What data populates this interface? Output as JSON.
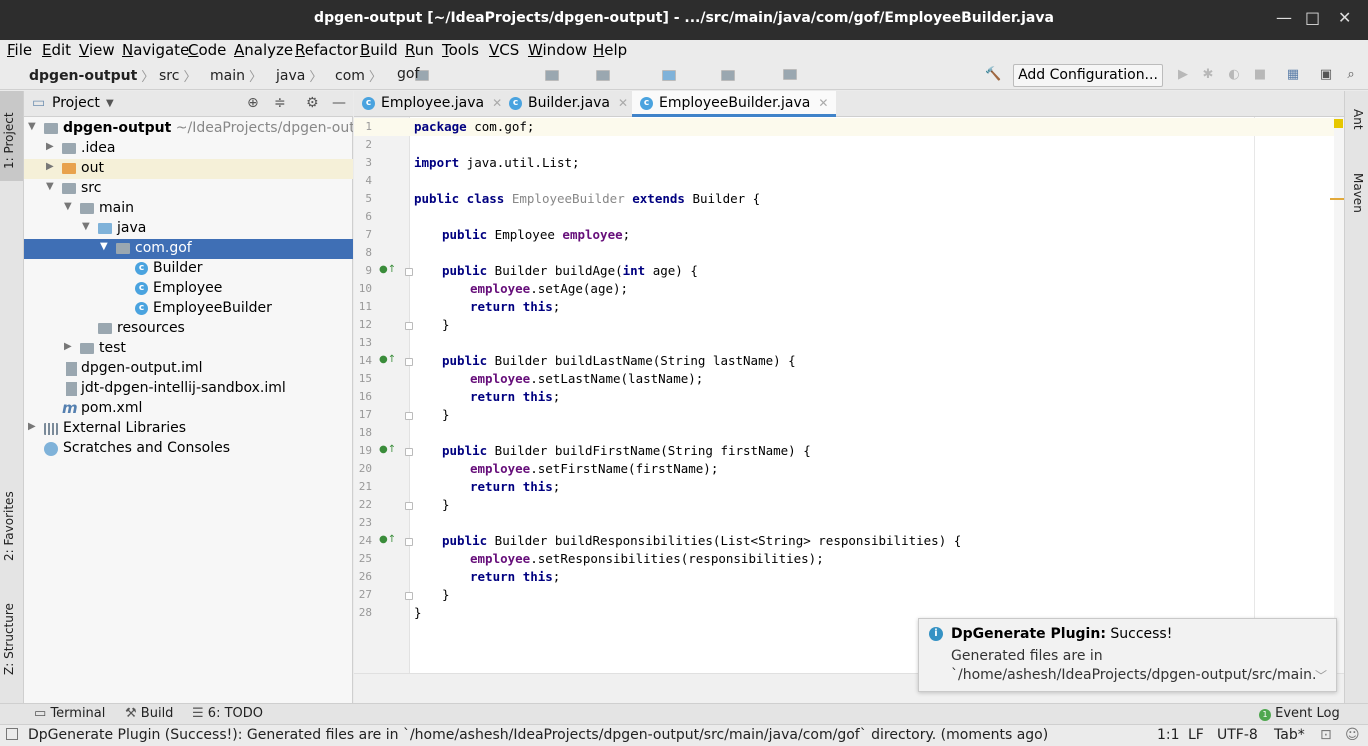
{
  "window": {
    "title": "dpgen-output [~/IdeaProjects/dpgen-output] - .../src/main/java/com/gof/EmployeeBuilder.java",
    "minimize": "—",
    "maximize": "□",
    "close": "✕"
  },
  "menu": [
    "File",
    "Edit",
    "View",
    "Navigate",
    "Code",
    "Analyze",
    "Refactor",
    "Build",
    "Run",
    "Tools",
    "VCS",
    "Window",
    "Help"
  ],
  "breadcrumb": [
    "dpgen-output",
    "src",
    "main",
    "java",
    "com",
    "gof"
  ],
  "toolbar": {
    "add_configuration": "Add Configuration..."
  },
  "left_strip": {
    "project": "1: Project",
    "favorites": "2: Favorites",
    "structure": "Z: Structure"
  },
  "right_strip": {
    "ant": "Ant",
    "maven": "Maven"
  },
  "project_panel": {
    "title": "Project",
    "tree": [
      {
        "label": "dpgen-output",
        "hint": "~/IdeaProjects/dpgen-output"
      },
      {
        "label": ".idea"
      },
      {
        "label": "out"
      },
      {
        "label": "src"
      },
      {
        "label": "main"
      },
      {
        "label": "java"
      },
      {
        "label": "com.gof"
      },
      {
        "label": "Builder"
      },
      {
        "label": "Employee"
      },
      {
        "label": "EmployeeBuilder"
      },
      {
        "label": "resources"
      },
      {
        "label": "test"
      },
      {
        "label": "dpgen-output.iml"
      },
      {
        "label": "jdt-dpgen-intellij-sandbox.iml"
      },
      {
        "label": "pom.xml"
      },
      {
        "label": "External Libraries"
      },
      {
        "label": "Scratches and Consoles"
      }
    ]
  },
  "tabs": [
    "Employee.java",
    "Builder.java",
    "EmployeeBuilder.java"
  ],
  "editor": {
    "line_numbers": [
      "1",
      "2",
      "3",
      "4",
      "5",
      "6",
      "7",
      "8",
      "9",
      "10",
      "11",
      "12",
      "13",
      "14",
      "15",
      "16",
      "17",
      "18",
      "19",
      "20",
      "21",
      "22",
      "23",
      "24",
      "25",
      "26",
      "27",
      "28"
    ],
    "code": {
      "l1_kw": "package",
      "l1_rest": " com.gof;",
      "l3_kw": "import",
      "l3_rest": " java.util.List;",
      "l5_kw1": "public class",
      "l5_name": " EmployeeBuilder ",
      "l5_kw2": "extends",
      "l5_rest": " Builder {",
      "l7_kw": "public",
      "l7_type": " Employee ",
      "l7_fld": "employee",
      "l7_rest": ";",
      "l9_kw": "public",
      "l9_a": " Builder buildAge(",
      "l9_kw2": "int",
      "l9_b": " age) {",
      "l10_fld": "employee",
      "l10_rest": ".setAge(age);",
      "ret_kw": "return",
      "ret_this": "this",
      "ret_semi": ";",
      "close_brace": "}",
      "l14_kw": "public",
      "l14_rest": " Builder buildLastName(String lastName) {",
      "l15_fld": "employee",
      "l15_rest": ".setLastName(lastName);",
      "l19_kw": "public",
      "l19_rest": " Builder buildFirstName(String firstName) {",
      "l20_fld": "employee",
      "l20_rest": ".setFirstName(firstName);",
      "l24_kw": "public",
      "l24_rest": " Builder buildResponsibilities(List<String> responsibilities) {",
      "l25_fld": "employee",
      "l25_rest": ".setResponsibilities(responsibilities);"
    }
  },
  "notification": {
    "title": "DpGenerate Plugin:",
    "status": " Success!",
    "line1": "Generated files are in",
    "line2": "`/home/ashesh/IdeaProjects/dpgen-output/src/main."
  },
  "tool_windows": {
    "terminal": "Terminal",
    "build": "Build",
    "todo": "6: TODO",
    "event_log": "Event Log"
  },
  "status_bar": {
    "message": "DpGenerate Plugin (Success!): Generated files are in `/home/ashesh/IdeaProjects/dpgen-output/src/main/java/com/gof` directory. (moments ago)",
    "position": "1:1",
    "line_sep": "LF",
    "encoding": "UTF-8",
    "indent": "Tab*"
  },
  "colors": {
    "keyword": "#000080",
    "field": "#660e7a",
    "selection": "#3f6fb5",
    "tab_underline": "#4083c9"
  }
}
